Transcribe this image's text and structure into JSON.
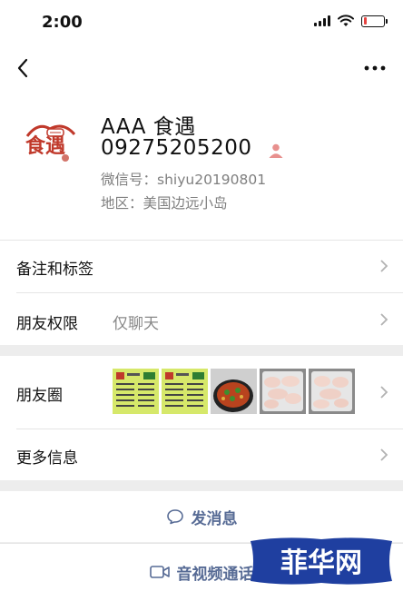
{
  "status_bar": {
    "time": "2:00",
    "battery_level": 0.15,
    "battery_color": "#e64340"
  },
  "nav": {
    "back_icon": "chevron-left-icon",
    "more_icon": "more-dots-icon"
  },
  "profile": {
    "avatar_text": "食遇",
    "name": "AAA 食遇",
    "phone": "09275205200",
    "badge_icon": "enterprise-user-icon",
    "wechat_id": "微信号：shiyu20190801",
    "region": "地区：美国边远小岛"
  },
  "rows": {
    "remark": {
      "label": "备注和标签"
    },
    "permission": {
      "label": "朋友权限",
      "value": "仅聊天"
    },
    "moments": {
      "label": "朋友圈"
    },
    "more_info": {
      "label": "更多信息"
    }
  },
  "actions": {
    "message": {
      "label": "发消息",
      "icon": "chat-bubble-icon"
    },
    "call": {
      "label": "音视频通话",
      "icon": "video-camera-icon"
    }
  },
  "watermark": {
    "text": "菲华网"
  },
  "colors": {
    "link_blue": "#576b95",
    "secondary_text": "#7f7f7f",
    "page_bg": "#ededed",
    "watermark_blue": "#1f3fa0"
  }
}
